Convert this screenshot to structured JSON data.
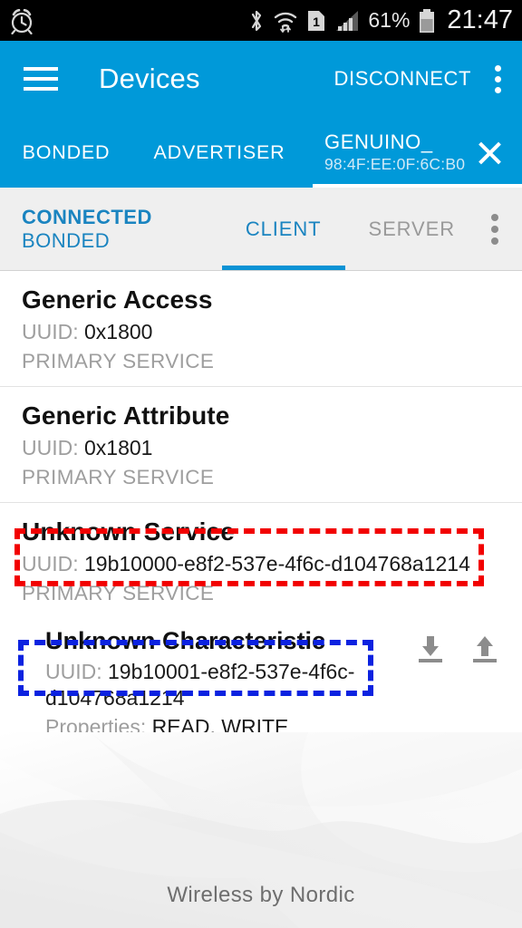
{
  "status_bar": {
    "alarm_icon": "alarm-clock-icon",
    "bluetooth_icon": "bluetooth-icon",
    "wifi_icon": "wifi-icon",
    "sim_icon": "sim-1-icon",
    "signal_icon": "cellular-signal-icon",
    "battery_percent": "61%",
    "battery_icon": "battery-icon",
    "time": "21:47"
  },
  "action_bar": {
    "menu_icon": "hamburger-menu-icon",
    "title": "Devices",
    "disconnect_label": "DISCONNECT",
    "overflow_icon": "kebab-menu-icon"
  },
  "tabs": {
    "bonded": "BONDED",
    "advertiser": "ADVERTISER",
    "device_name": "GENUINO_",
    "device_mac": "98:4F:EE:0F:6C:B0",
    "close_icon": "close-icon",
    "active": "device"
  },
  "sub_bar": {
    "connection_state": "CONNECTED",
    "bond_state": "BONDED",
    "client_label": "CLIENT",
    "server_label": "SERVER",
    "active_tab": "CLIENT",
    "overflow_icon": "kebab-menu-icon"
  },
  "services": [
    {
      "name": "Generic Access",
      "uuid_label": "UUID:",
      "uuid_value": "0x1800",
      "type": "PRIMARY SERVICE"
    },
    {
      "name": "Generic Attribute",
      "uuid_label": "UUID:",
      "uuid_value": "0x1801",
      "type": "PRIMARY SERVICE"
    },
    {
      "name": "Unknown Service",
      "uuid_label": "UUID:",
      "uuid_value": "19b10000-e8f2-537e-4f6c-d104768a1214",
      "type": "PRIMARY SERVICE"
    }
  ],
  "characteristic": {
    "name": "Unknown Characteristic",
    "uuid_label": "UUID:",
    "uuid_value": "19b10001-e8f2-537e-4f6c-d104768a1214",
    "properties_label": "Properties:",
    "properties_value": "READ, WRITE",
    "read_icon": "download-read-icon",
    "write_icon": "upload-write-icon"
  },
  "annotations": {
    "red_box_color": "#f20000",
    "blue_box_color": "#0b22e0"
  },
  "footer": {
    "text": "Wireless by Nordic"
  },
  "theme": {
    "primary_blue": "#0099d9",
    "accent_blue": "#1a84c0",
    "subbar_bg": "#efefef"
  }
}
